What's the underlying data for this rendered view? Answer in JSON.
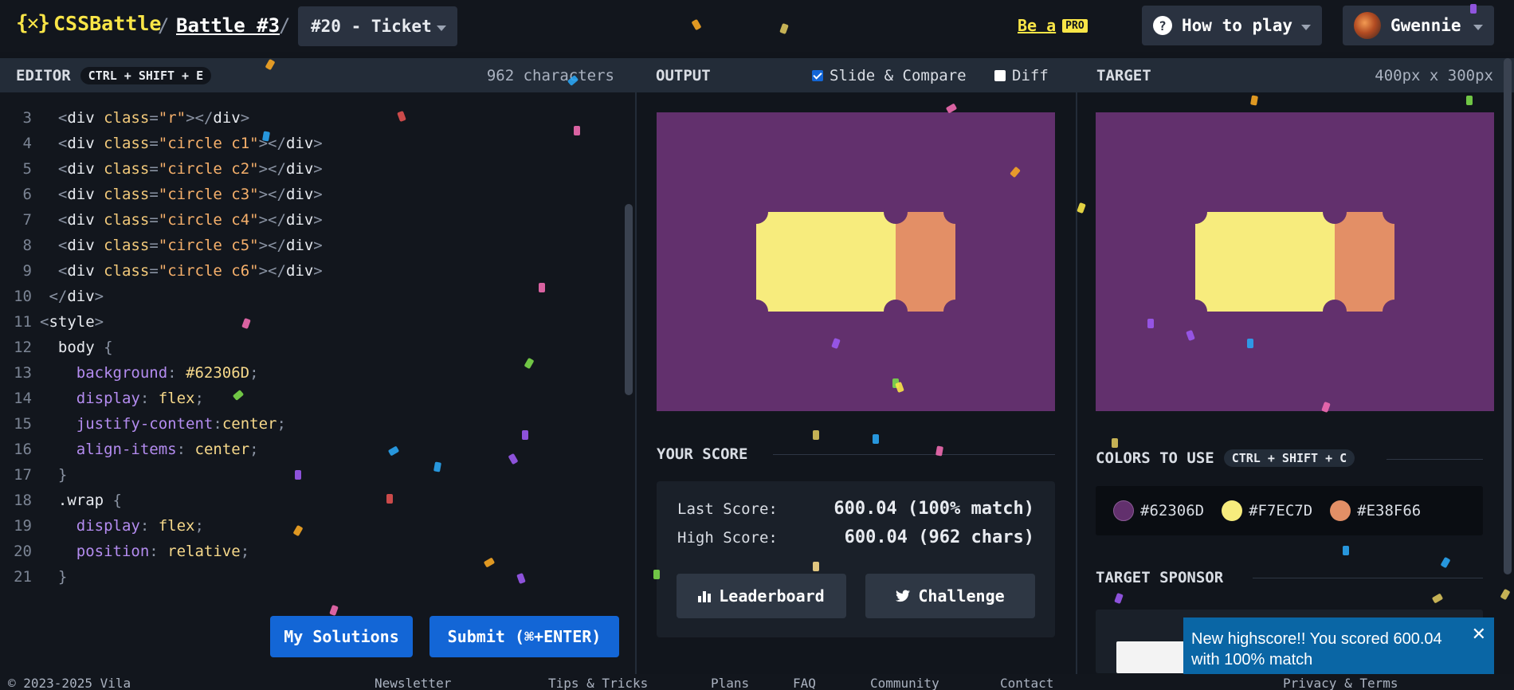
{
  "header": {
    "logo_text": "CSSBattle",
    "logo_mark": "{✕}",
    "battle_link": "Battle #3",
    "target_select": "#20 - Ticket",
    "be_a": "Be a",
    "pro": "PRO",
    "how_to_play": "How to play",
    "username": "Gwennie"
  },
  "editor": {
    "title": "EDITOR",
    "shortcut": "CTRL + SHIFT + E",
    "char_count": "962 characters",
    "lines": [
      {
        "n": "3",
        "indent": "  ",
        "tokens": [
          [
            "t-punc",
            "<"
          ],
          [
            "t-tag",
            "div "
          ],
          [
            "t-attr",
            "class"
          ],
          [
            "t-punc",
            "="
          ],
          [
            "t-str",
            "\"r\""
          ],
          [
            "t-punc",
            "></"
          ],
          [
            "t-tag",
            "div"
          ],
          [
            "t-punc",
            ">"
          ]
        ]
      },
      {
        "n": "4",
        "indent": "  ",
        "tokens": [
          [
            "t-punc",
            "<"
          ],
          [
            "t-tag",
            "div "
          ],
          [
            "t-attr",
            "class"
          ],
          [
            "t-punc",
            "="
          ],
          [
            "t-str",
            "\"circle c1\""
          ],
          [
            "t-punc",
            "></"
          ],
          [
            "t-tag",
            "div"
          ],
          [
            "t-punc",
            ">"
          ]
        ]
      },
      {
        "n": "5",
        "indent": "  ",
        "tokens": [
          [
            "t-punc",
            "<"
          ],
          [
            "t-tag",
            "div "
          ],
          [
            "t-attr",
            "class"
          ],
          [
            "t-punc",
            "="
          ],
          [
            "t-str",
            "\"circle c2\""
          ],
          [
            "t-punc",
            "></"
          ],
          [
            "t-tag",
            "div"
          ],
          [
            "t-punc",
            ">"
          ]
        ]
      },
      {
        "n": "6",
        "indent": "  ",
        "tokens": [
          [
            "t-punc",
            "<"
          ],
          [
            "t-tag",
            "div "
          ],
          [
            "t-attr",
            "class"
          ],
          [
            "t-punc",
            "="
          ],
          [
            "t-str",
            "\"circle c3\""
          ],
          [
            "t-punc",
            "></"
          ],
          [
            "t-tag",
            "div"
          ],
          [
            "t-punc",
            ">"
          ]
        ]
      },
      {
        "n": "7",
        "indent": "  ",
        "tokens": [
          [
            "t-punc",
            "<"
          ],
          [
            "t-tag",
            "div "
          ],
          [
            "t-attr",
            "class"
          ],
          [
            "t-punc",
            "="
          ],
          [
            "t-str",
            "\"circle c4\""
          ],
          [
            "t-punc",
            "></"
          ],
          [
            "t-tag",
            "div"
          ],
          [
            "t-punc",
            ">"
          ]
        ]
      },
      {
        "n": "8",
        "indent": "  ",
        "tokens": [
          [
            "t-punc",
            "<"
          ],
          [
            "t-tag",
            "div "
          ],
          [
            "t-attr",
            "class"
          ],
          [
            "t-punc",
            "="
          ],
          [
            "t-str",
            "\"circle c5\""
          ],
          [
            "t-punc",
            "></"
          ],
          [
            "t-tag",
            "div"
          ],
          [
            "t-punc",
            ">"
          ]
        ]
      },
      {
        "n": "9",
        "indent": "  ",
        "tokens": [
          [
            "t-punc",
            "<"
          ],
          [
            "t-tag",
            "div "
          ],
          [
            "t-attr",
            "class"
          ],
          [
            "t-punc",
            "="
          ],
          [
            "t-str",
            "\"circle c6\""
          ],
          [
            "t-punc",
            "></"
          ],
          [
            "t-tag",
            "div"
          ],
          [
            "t-punc",
            ">"
          ]
        ]
      },
      {
        "n": "10",
        "indent": " ",
        "tokens": [
          [
            "t-punc",
            "</"
          ],
          [
            "t-tag",
            "div"
          ],
          [
            "t-punc",
            ">"
          ]
        ]
      },
      {
        "n": "11",
        "indent": "",
        "tokens": [
          [
            "t-punc",
            "<"
          ],
          [
            "t-tag",
            "style"
          ],
          [
            "t-punc",
            ">"
          ]
        ]
      },
      {
        "n": "12",
        "indent": "  ",
        "tokens": [
          [
            "t-sel",
            "body "
          ],
          [
            "t-punc",
            "{"
          ]
        ]
      },
      {
        "n": "13",
        "indent": "    ",
        "tokens": [
          [
            "t-prop",
            "background"
          ],
          [
            "t-punc",
            ": "
          ],
          [
            "t-val",
            "#62306D"
          ],
          [
            "t-punc",
            ";"
          ]
        ]
      },
      {
        "n": "14",
        "indent": "    ",
        "tokens": [
          [
            "t-prop",
            "display"
          ],
          [
            "t-punc",
            ": "
          ],
          [
            "t-val",
            "flex"
          ],
          [
            "t-punc",
            ";"
          ]
        ]
      },
      {
        "n": "15",
        "indent": "    ",
        "tokens": [
          [
            "t-prop",
            "justify-content"
          ],
          [
            "t-punc",
            ":"
          ],
          [
            "t-val",
            "center"
          ],
          [
            "t-punc",
            ";"
          ]
        ]
      },
      {
        "n": "16",
        "indent": "    ",
        "tokens": [
          [
            "t-prop",
            "align-items"
          ],
          [
            "t-punc",
            ": "
          ],
          [
            "t-val",
            "center"
          ],
          [
            "t-punc",
            ";"
          ]
        ]
      },
      {
        "n": "17",
        "indent": "  ",
        "tokens": [
          [
            "t-punc",
            "}"
          ]
        ]
      },
      {
        "n": "18",
        "indent": "  ",
        "tokens": [
          [
            "t-sel",
            ".wrap "
          ],
          [
            "t-punc",
            "{"
          ]
        ]
      },
      {
        "n": "19",
        "indent": "    ",
        "tokens": [
          [
            "t-prop",
            "display"
          ],
          [
            "t-punc",
            ": "
          ],
          [
            "t-val",
            "flex"
          ],
          [
            "t-punc",
            ";"
          ]
        ]
      },
      {
        "n": "20",
        "indent": "    ",
        "tokens": [
          [
            "t-prop",
            "position"
          ],
          [
            "t-punc",
            ": "
          ],
          [
            "t-val",
            "relative"
          ],
          [
            "t-punc",
            ";"
          ]
        ]
      },
      {
        "n": "21",
        "indent": "  ",
        "tokens": [
          [
            "t-punc",
            "}"
          ]
        ]
      }
    ],
    "my_solutions": "My Solutions",
    "submit": "Submit (⌘+ENTER)"
  },
  "output": {
    "title": "OUTPUT",
    "slide_compare": "Slide & Compare",
    "slide_compare_checked": true,
    "diff": "Diff",
    "diff_checked": false
  },
  "score": {
    "title": "YOUR SCORE",
    "last_label": "Last Score:",
    "last_value": "600.04 (100% match)",
    "high_label": "High Score:",
    "high_value": "600.04 (962 chars)",
    "leaderboard": "Leaderboard",
    "challenge": "Challenge"
  },
  "target": {
    "title": "TARGET",
    "size": "400px x 300px",
    "colors_title": "COLORS TO USE",
    "colors_shortcut": "CTRL + SHIFT + C",
    "colors": [
      {
        "label": "#62306D",
        "hex": "#62306D"
      },
      {
        "label": "#F7EC7D",
        "hex": "#F7EC7D"
      },
      {
        "label": "#E38F66",
        "hex": "#E38F66"
      }
    ],
    "sponsor_title": "TARGET SPONSOR"
  },
  "toast": {
    "message": "New highscore!! You scored 600.04 with 100% match",
    "close": "✕"
  },
  "footer": {
    "copyright": "© 2023-2025 Vila",
    "items": [
      "Newsletter",
      "Tips & Tricks",
      "Plans",
      "FAQ",
      "Community",
      "Contact",
      "Privacy & Terms"
    ]
  }
}
